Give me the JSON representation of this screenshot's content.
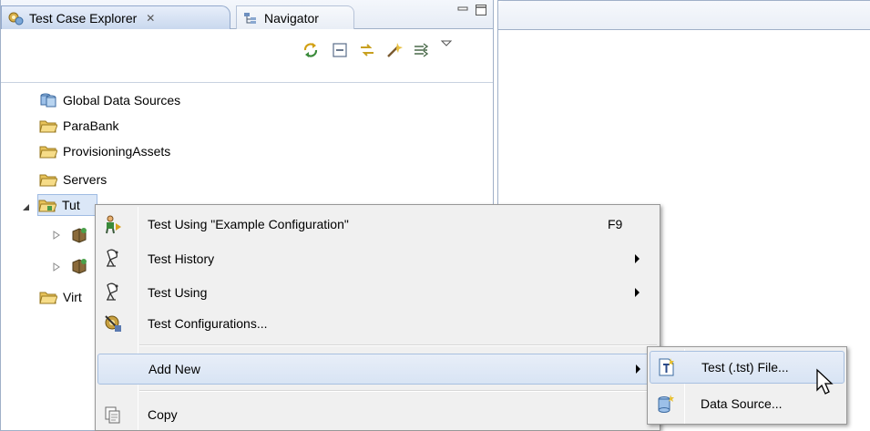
{
  "left_view": {
    "tabs": [
      {
        "label": "Test Case Explorer",
        "close_glyph": "✕",
        "icon": "test-case-explorer-icon",
        "active": true
      },
      {
        "label": "Navigator",
        "icon": "navigator-icon",
        "active": false
      }
    ]
  },
  "tree": {
    "items": [
      {
        "label": "Global Data Sources",
        "icon": "data-sources-icon"
      },
      {
        "label": "ParaBank",
        "icon": "folder-icon"
      },
      {
        "label": "ProvisioningAssets",
        "icon": "folder-icon"
      },
      {
        "label": "Servers",
        "icon": "folder-icon"
      },
      {
        "label": "Tut",
        "icon": "project-folder-icon",
        "expanded": true
      },
      {
        "label": "Virt",
        "icon": "folder-icon"
      }
    ]
  },
  "context_menu": {
    "items": [
      {
        "label": "Test Using \"Example Configuration\"",
        "accel": "F9",
        "icon": "test-run-icon"
      },
      {
        "label": "Test History",
        "icon": "test-history-icon",
        "submenu": true
      },
      {
        "label": "Test Using",
        "icon": "test-using-icon",
        "submenu": true
      },
      {
        "label": "Test Configurations...",
        "icon": "test-configurations-icon"
      },
      {
        "label": "Add New",
        "submenu": true,
        "hover": true
      },
      {
        "label": "Copy",
        "icon": "copy-icon"
      }
    ]
  },
  "submenu": {
    "items": [
      {
        "label": "Test (.tst) File...",
        "icon": "new-test-file-icon",
        "hover": true
      },
      {
        "label": "Data Source...",
        "icon": "new-data-source-icon"
      }
    ]
  },
  "colors": {
    "folder": "#e8c35a",
    "menu_bg": "#f0f0f0",
    "hover": "#d8e4f4"
  }
}
